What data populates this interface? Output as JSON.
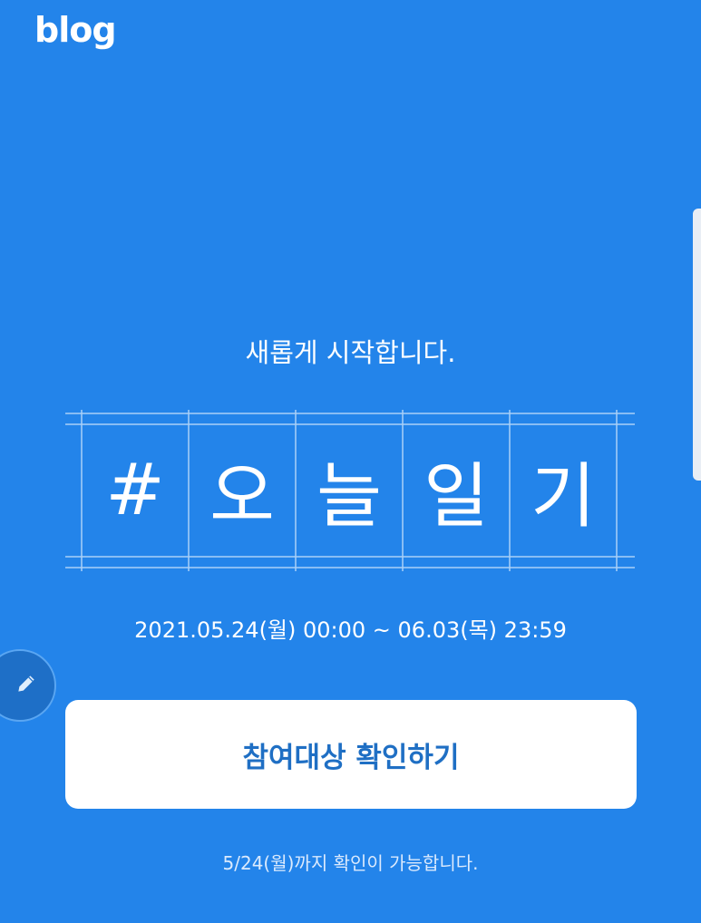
{
  "header": {
    "logo_text": "blog"
  },
  "hero": {
    "headline": "새롭게 시작합니다.",
    "hashtag_chars": [
      "#",
      "오",
      "늘",
      "일",
      "기"
    ],
    "date_range": "2021.05.24(월) 00:00 ~ 06.03(목) 23:59"
  },
  "cta": {
    "label": "참여대상 확인하기",
    "note": "5/24(월)까지 확인이 가능합니다."
  },
  "icons": {
    "edit": "pencil-icon"
  },
  "colors": {
    "background": "#2384ea",
    "cta_background": "#ffffff",
    "cta_text": "#1f6fc4"
  }
}
